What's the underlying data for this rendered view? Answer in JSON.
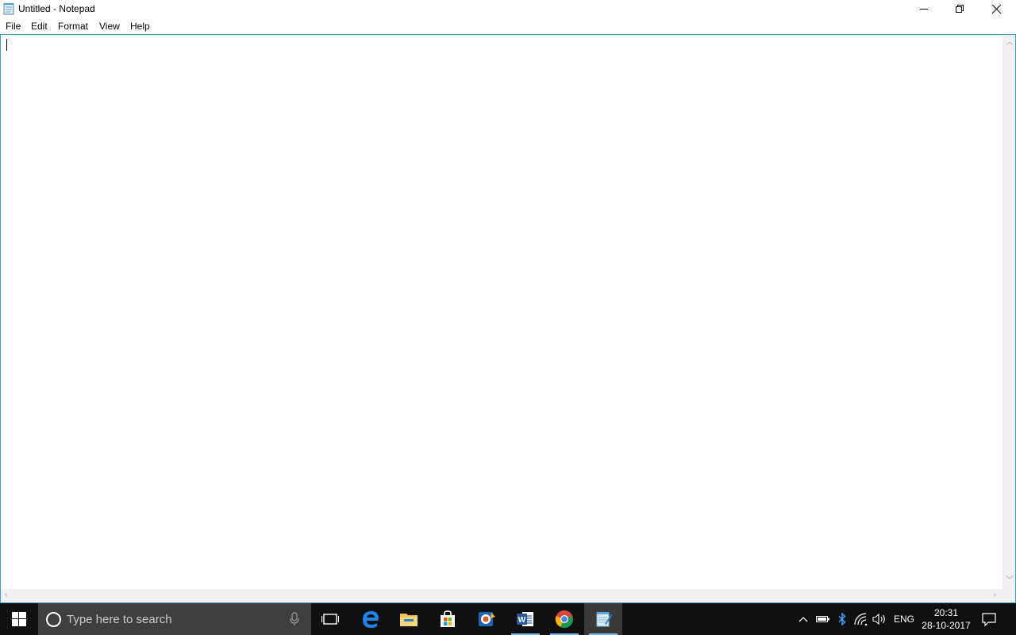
{
  "window": {
    "title": "Untitled - Notepad"
  },
  "menu": [
    {
      "label": "File"
    },
    {
      "label": "Edit"
    },
    {
      "label": "Format"
    },
    {
      "label": "View"
    },
    {
      "label": "Help"
    }
  ],
  "editor": {
    "text": ""
  },
  "taskbar": {
    "search_placeholder": "Type here to search",
    "apps": [
      {
        "name": "Task View",
        "icon": "task-view-icon"
      },
      {
        "name": "Microsoft Edge",
        "icon": "edge-icon"
      },
      {
        "name": "File Explorer",
        "icon": "folder-icon"
      },
      {
        "name": "Microsoft Store",
        "icon": "store-icon"
      },
      {
        "name": "Photos app",
        "icon": "photos-icon"
      },
      {
        "name": "Microsoft Word",
        "icon": "word-icon"
      },
      {
        "name": "Google Chrome",
        "icon": "chrome-icon"
      },
      {
        "name": "Notepad",
        "icon": "notepad-icon"
      }
    ],
    "tray": {
      "language": "ENG",
      "time": "20:31",
      "date": "28-10-2017"
    }
  },
  "colors": {
    "accent": "#3f9ac9",
    "taskbar": "#101010",
    "search_box": "#3f3f3f",
    "running_indicator": "#76b9ed"
  }
}
